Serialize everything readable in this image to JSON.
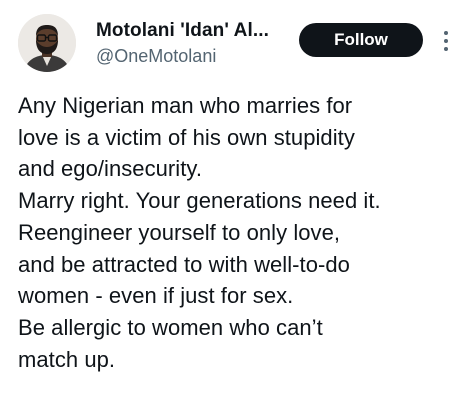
{
  "author": {
    "name": "Motolani 'Idan' Al...",
    "handle": "@OneMotolani",
    "avatar_icon": "profile-photo"
  },
  "follow_button": {
    "label": "Follow",
    "bg_color": "#0f1419",
    "text_color": "#ffffff"
  },
  "more_menu": {
    "icon": "more-vertical-icon"
  },
  "tweet": {
    "lines": [
      "Any Nigerian man who marries for",
      "love is a victim of his own stupidity",
      "and ego/insecurity.",
      "Marry right. Your generations need it.",
      "Reengineer yourself to only love,",
      "and be attracted to with well-to-do",
      "women - even if just for sex.",
      "Be allergic to women who can’t",
      "match up."
    ]
  }
}
